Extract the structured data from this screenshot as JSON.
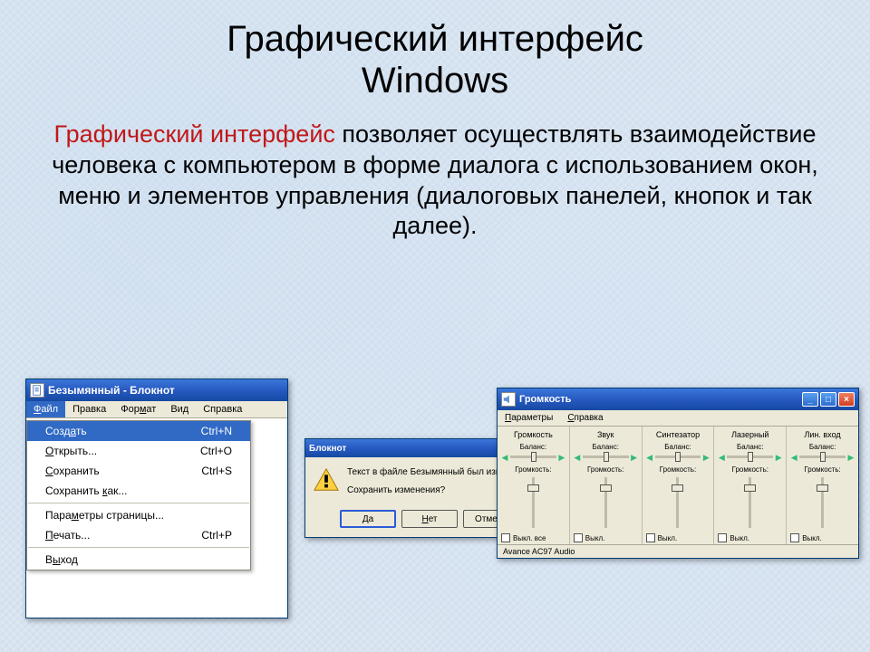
{
  "slide": {
    "title_line1": "Графический интерфейс",
    "title_line2": "Windows",
    "term": "Графический интерфейс",
    "body_rest": " позволяет осуществлять взаимодействие человека с компьютером в форме диалога с использованием окон, меню и элементов управления (диалоговых панелей, кнопок и так далее)."
  },
  "notepad": {
    "title": "Безымянный - Блокнот",
    "menu": {
      "file": "Файл",
      "edit": "Правка",
      "format": "Формат",
      "view": "Вид",
      "help": "Справка"
    },
    "file_menu": {
      "create": "Создать",
      "create_kb": "Ctrl+N",
      "open": "Открыть...",
      "open_kb": "Ctrl+O",
      "save": "Сохранить",
      "save_kb": "Ctrl+S",
      "saveas": "Сохранить как...",
      "pagesetup": "Параметры страницы...",
      "print": "Печать...",
      "print_kb": "Ctrl+P",
      "exit": "Выход"
    }
  },
  "dialog": {
    "title": "Блокнот",
    "line1": "Текст в файле Безымянный был изменен.",
    "line2": "Сохранить изменения?",
    "yes": "Да",
    "no": "Нет",
    "cancel": "Отмена"
  },
  "mixer": {
    "title": "Громкость",
    "menu": {
      "params": "Параметры",
      "help": "Справка"
    },
    "balance_label": "Баланс:",
    "volume_label": "Громкость:",
    "channels": [
      {
        "name": "Громкость",
        "mute": "Выкл. все"
      },
      {
        "name": "Звук",
        "mute": "Выкл."
      },
      {
        "name": "Синтезатор",
        "mute": "Выкл."
      },
      {
        "name": "Лазерный",
        "mute": "Выкл."
      },
      {
        "name": "Лин. вход",
        "mute": "Выкл."
      }
    ],
    "status": "Avance AC97 Audio"
  }
}
